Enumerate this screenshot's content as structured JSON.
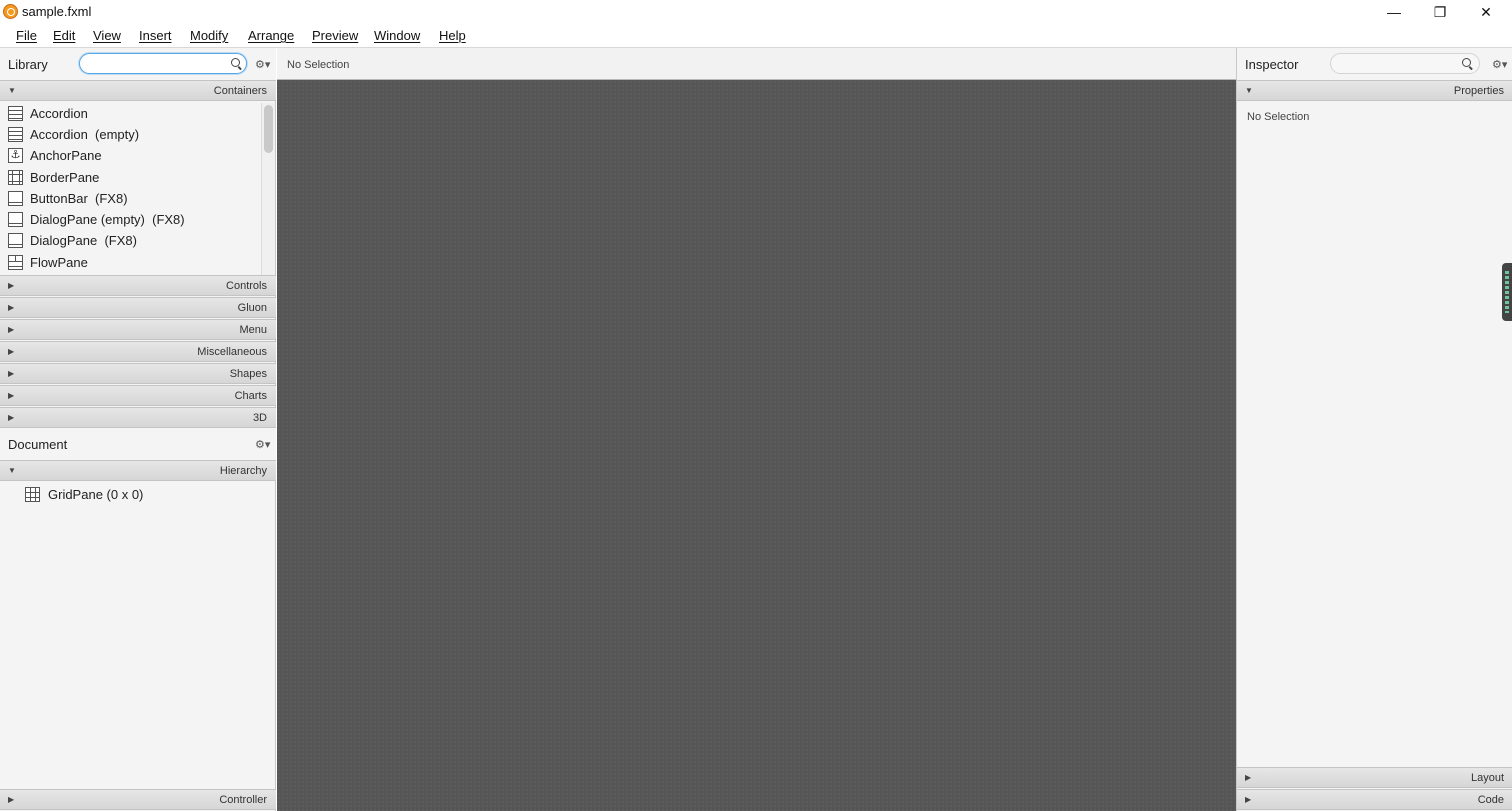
{
  "window": {
    "title": "sample.fxml",
    "minimize_glyph": "—",
    "maximize_glyph": "❐",
    "close_glyph": "✕"
  },
  "menu": [
    "File",
    "Edit",
    "View",
    "Insert",
    "Modify",
    "Arrange",
    "Preview",
    "Window",
    "Help"
  ],
  "library": {
    "title": "Library",
    "search_value": "",
    "gear_glyph": "⚙▾",
    "expanded_glyph": "▼",
    "collapsed_glyph": "▶",
    "sections": {
      "containers": "Containers",
      "controls": "Controls",
      "gluon": "Gluon",
      "menu": "Menu",
      "miscellaneous": "Miscellaneous",
      "shapes": "Shapes",
      "charts": "Charts",
      "three_d": "3D"
    },
    "items": [
      {
        "label": "Accordion",
        "icon": "accordion-icon"
      },
      {
        "label": "Accordion  (empty)",
        "icon": "accordion-icon"
      },
      {
        "label": "AnchorPane",
        "icon": "anchor-icon"
      },
      {
        "label": "BorderPane",
        "icon": "border-pane-icon"
      },
      {
        "label": "ButtonBar  (FX8)",
        "icon": "button-bar-icon"
      },
      {
        "label": "DialogPane (empty)  (FX8)",
        "icon": "dialog-pane-icon"
      },
      {
        "label": "DialogPane  (FX8)",
        "icon": "dialog-pane-icon"
      },
      {
        "label": "FlowPane",
        "icon": "flow-pane-icon"
      }
    ],
    "anchor_glyph": "⚓"
  },
  "document": {
    "title": "Document",
    "gear_glyph": "⚙▾",
    "hierarchy_label": "Hierarchy",
    "hierarchy_items": [
      {
        "label": "GridPane (0 x 0)",
        "icon": "grid-pane-icon"
      }
    ],
    "controller_label": "Controller"
  },
  "center": {
    "selection_text": "No Selection"
  },
  "inspector": {
    "title": "Inspector",
    "search_value": "",
    "gear_glyph": "⚙▾",
    "properties_label": "Properties",
    "empty_text": "No Selection",
    "layout_label": "Layout",
    "code_label": "Code"
  },
  "colors": {
    "canvas": "#565656",
    "panel": "#f4f4f4",
    "search_focus": "#5aa7e6",
    "app_icon": "#f39a1e"
  }
}
